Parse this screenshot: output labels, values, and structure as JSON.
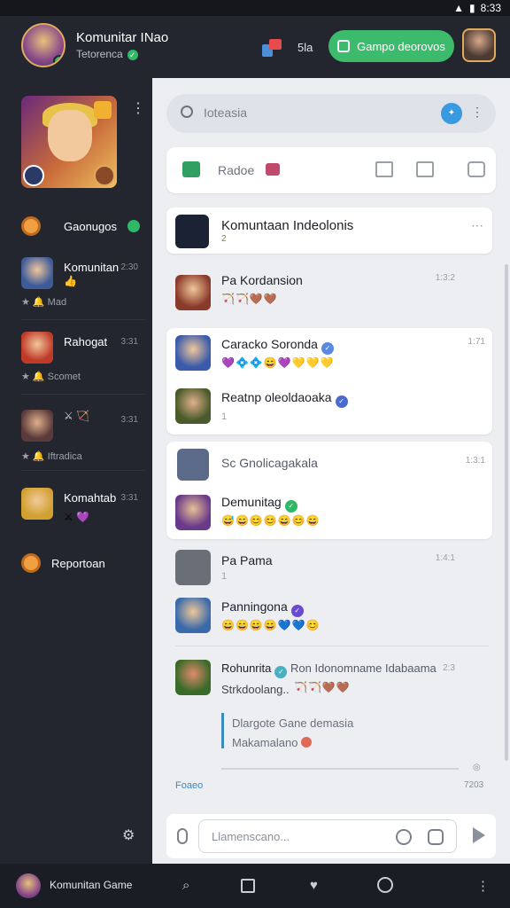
{
  "status_bar": {
    "time": "8:33"
  },
  "header": {
    "title": "Komunitar INao",
    "subtitle": "Tetorenca",
    "notification_count": "5la",
    "join_label": "Gampo deorovos"
  },
  "sidebar": {
    "items": [
      {
        "label": "Gaonugos",
        "time": "",
        "sub": ""
      },
      {
        "label": "Komunitan",
        "time": "2:30",
        "sub": "★ 🔔 Mad",
        "emojis": "👍"
      },
      {
        "label": "Rahogat",
        "time": "3:31",
        "sub": "★ 🔔 Scomet",
        "emojis": ""
      },
      {
        "label": "",
        "time": "3:31",
        "sub": "★ 🔔 Iftradica",
        "emojis": "⚔ 🏹"
      },
      {
        "label": "Komahtab",
        "time": "3:31",
        "sub": "",
        "emojis": "⚔ 💜"
      },
      {
        "label": "Reportoan",
        "time": "",
        "sub": ""
      }
    ]
  },
  "main": {
    "search_placeholder": "Ioteasia",
    "tool_label": "Radoe",
    "community_title": "Komuntaan Indeolonis",
    "community_sub": "2",
    "chats": [
      {
        "name": "Pa Kordansion",
        "time": "1:3:2",
        "emojis": "🏹🏹🤎🤎",
        "sub": ""
      },
      {
        "name": "Caracko Soronda",
        "time": "1:71",
        "emojis": "💜💠💠😄💜💛💛💛",
        "sub": ""
      },
      {
        "name": "Reatnp oleoldaoaka",
        "time": "",
        "emojis": "",
        "sub": "1"
      },
      {
        "name": "Sc Gnolicagakala",
        "time": "1:3:1",
        "emojis": "",
        "sub": ""
      },
      {
        "name": "Demunitag",
        "time": "",
        "emojis": "😅😄😊😊😄😊😄",
        "sub": ""
      },
      {
        "name": "Pa Pama",
        "time": "1:4:1",
        "emojis": "",
        "sub": "1"
      },
      {
        "name": "Panningona",
        "time": "",
        "emojis": "😄😄😄😄💙💙😊",
        "sub": ""
      },
      {
        "name": "Rohunrita",
        "time": "2:3",
        "extra": "Ron Idonomname Idabaama",
        "emojis": "🏹🏹🤎🤎",
        "sub": "Strkdoolang.."
      },
      {
        "name": "Dlargote Gane demasia",
        "time": "",
        "emojis": "",
        "sub": ""
      },
      {
        "name": "Makamalano",
        "time": "",
        "emojis": "",
        "sub": ""
      }
    ],
    "footer_left": "Foaeo",
    "footer_right": "7203",
    "composer_placeholder": "Llamenscano..."
  },
  "bottom_nav": {
    "profile_label": "Komunitan Game"
  }
}
